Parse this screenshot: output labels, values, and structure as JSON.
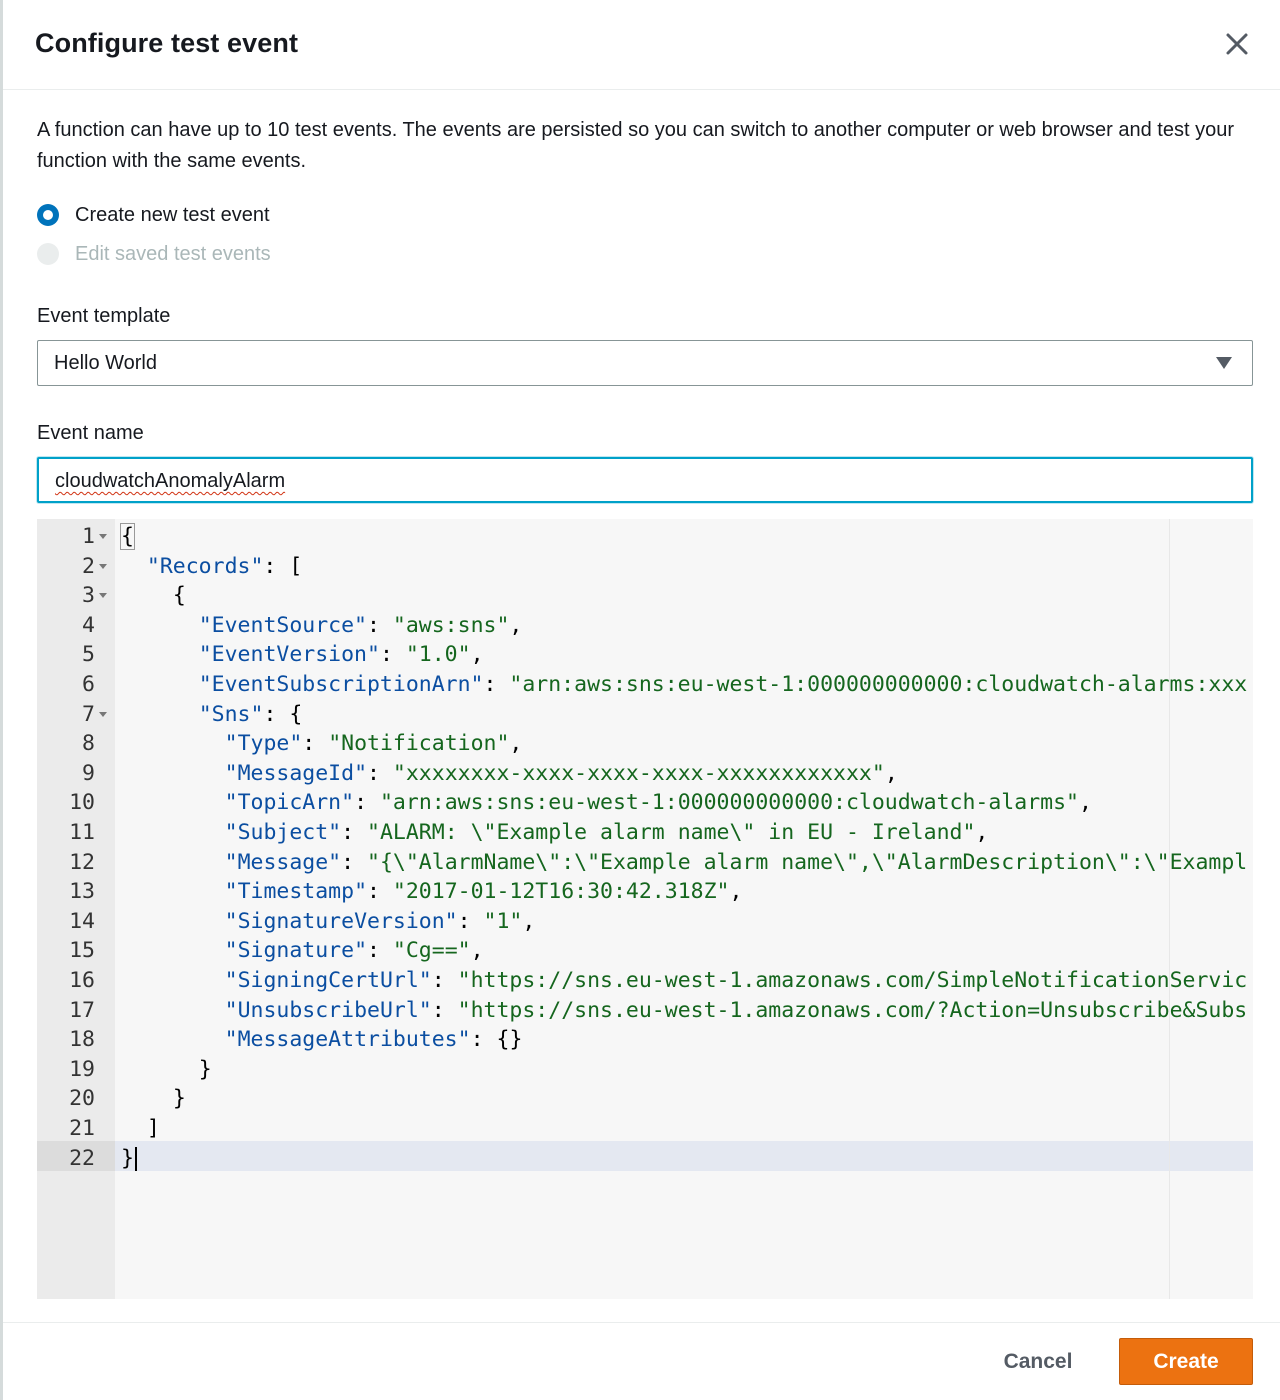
{
  "dialog": {
    "title": "Configure test event",
    "close_icon": "close-icon",
    "description": "A function can have up to 10 test events. The events are persisted so you can switch to another computer or web browser and test your function with the same events."
  },
  "options": {
    "create_new": {
      "label": "Create new test event",
      "selected": true
    },
    "edit_saved": {
      "label": "Edit saved test events",
      "disabled": true
    }
  },
  "template": {
    "label": "Event template",
    "value": "Hello World"
  },
  "event_name": {
    "label": "Event name",
    "value": "cloudwatchAnomalyAlarm"
  },
  "editor": {
    "lines": [
      "{",
      "  \"Records\": [",
      "    {",
      "      \"EventSource\": \"aws:sns\",",
      "      \"EventVersion\": \"1.0\",",
      "      \"EventSubscriptionArn\": \"arn:aws:sns:eu-west-1:000000000000:cloudwatch-alarms:xxx",
      "      \"Sns\": {",
      "        \"Type\": \"Notification\",",
      "        \"MessageId\": \"xxxxxxxx-xxxx-xxxx-xxxx-xxxxxxxxxxxx\",",
      "        \"TopicArn\": \"arn:aws:sns:eu-west-1:000000000000:cloudwatch-alarms\",",
      "        \"Subject\": \"ALARM: \\\"Example alarm name\\\" in EU - Ireland\",",
      "        \"Message\": \"{\\\"AlarmName\\\":\\\"Example alarm name\\\",\\\"AlarmDescription\\\":\\\"Exampl",
      "        \"Timestamp\": \"2017-01-12T16:30:42.318Z\",",
      "        \"SignatureVersion\": \"1\",",
      "        \"Signature\": \"Cg==\",",
      "        \"SigningCertUrl\": \"https://sns.eu-west-1.amazonaws.com/SimpleNotificationServic",
      "        \"UnsubscribeUrl\": \"https://sns.eu-west-1.amazonaws.com/?Action=Unsubscribe&Subs",
      "        \"MessageAttributes\": {}",
      "      }",
      "    }",
      "  ]",
      "}"
    ],
    "foldable_lines": [
      1,
      2,
      3,
      7
    ],
    "active_line": 22,
    "colors": {
      "key": "#0b4ea1",
      "string": "#15661e"
    }
  },
  "footer": {
    "cancel_label": "Cancel",
    "create_label": "Create",
    "create_color": "#ec7211"
  }
}
